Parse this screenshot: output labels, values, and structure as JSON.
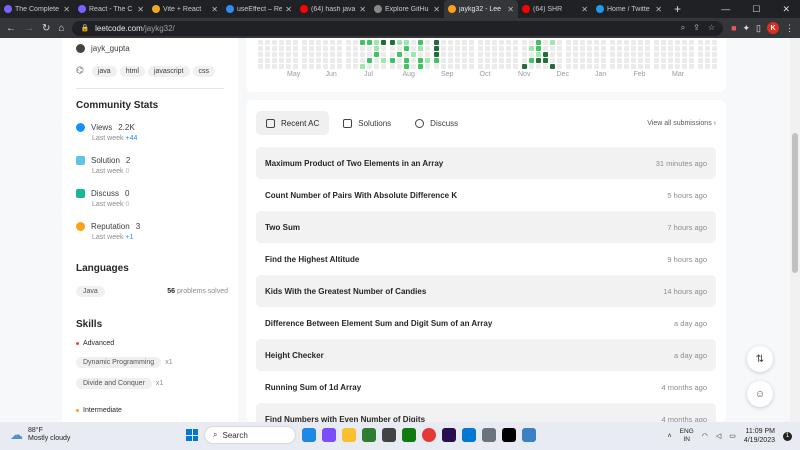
{
  "browser": {
    "tabs": [
      {
        "label": "The Complete",
        "fav": "#7b61ff"
      },
      {
        "label": "React - The C",
        "fav": "#7b61ff"
      },
      {
        "label": "Vite + React",
        "fav": "#f5a623"
      },
      {
        "label": "useEffect – Re",
        "fav": "#2f8cf0"
      },
      {
        "label": "(64) hash java",
        "fav": "#ff0000"
      },
      {
        "label": "Explore GitHu",
        "fav": "#888888"
      },
      {
        "label": "jaykg32 - Lee",
        "fav": "#ffa116",
        "active": true
      },
      {
        "label": "(64) SHR",
        "fav": "#ff0000"
      },
      {
        "label": "Home / Twitte",
        "fav": "#1d9bf0"
      }
    ],
    "url_host": "leetcode.com",
    "url_path": "/jaykg32/",
    "profile_initial": "K"
  },
  "profile": {
    "github": "jayk_gupta",
    "tags": [
      "java",
      "html",
      "javascript",
      "css"
    ]
  },
  "community": {
    "title": "Community Stats",
    "stats": [
      {
        "label": "Views",
        "value": "2.2K",
        "last_week": "Last week",
        "delta": "+44",
        "color": "#1890ff"
      },
      {
        "label": "Solution",
        "value": "2",
        "last_week": "Last week",
        "delta": "0",
        "color": "#5fc4e8"
      },
      {
        "label": "Discuss",
        "value": "0",
        "last_week": "Last week",
        "delta": "0",
        "color": "#17b897"
      },
      {
        "label": "Reputation",
        "value": "3",
        "last_week": "Last week",
        "delta": "+1",
        "color": "#ffa116"
      }
    ]
  },
  "languages": {
    "title": "Languages",
    "items": [
      {
        "name": "Java",
        "count": "56",
        "suffix": "problems solved"
      }
    ]
  },
  "skills": {
    "title": "Skills",
    "advanced": "Advanced",
    "advanced_items": [
      {
        "name": "Dynamic Programming",
        "count": "x1"
      },
      {
        "name": "Divide and Conquer",
        "count": "x1"
      }
    ],
    "intermediate": "Intermediate",
    "colors": {
      "advanced": "#ef4743",
      "intermediate": "#ffa116"
    }
  },
  "heatmap": {
    "months": [
      "May",
      "Jun",
      "Jul",
      "Aug",
      "Sep",
      "Oct",
      "Nov",
      "Dec",
      "Jan",
      "Feb",
      "Mar"
    ]
  },
  "submissions": {
    "tabs": [
      "Recent AC",
      "Solutions",
      "Discuss"
    ],
    "view_all": "View all submissions",
    "items": [
      {
        "title": "Maximum Product of Two Elements in an Array",
        "time": "31 minutes ago"
      },
      {
        "title": "Count Number of Pairs With Absolute Difference K",
        "time": "5 hours ago"
      },
      {
        "title": "Two Sum",
        "time": "7 hours ago"
      },
      {
        "title": "Find the Highest Altitude",
        "time": "9 hours ago"
      },
      {
        "title": "Kids With the Greatest Number of Candies",
        "time": "14 hours ago"
      },
      {
        "title": "Difference Between Element Sum and Digit Sum of an Array",
        "time": "a day ago"
      },
      {
        "title": "Height Checker",
        "time": "a day ago"
      },
      {
        "title": "Running Sum of 1d Array",
        "time": "4 months ago"
      },
      {
        "title": "Find Numbers with Even Number of Digits",
        "time": "4 months ago"
      }
    ]
  },
  "taskbar": {
    "temp": "88°F",
    "weather": "Mostly cloudy",
    "search": "Search",
    "lang_top": "ENG",
    "lang_bottom": "IN",
    "time": "11:09 PM",
    "date": "4/19/2023"
  }
}
